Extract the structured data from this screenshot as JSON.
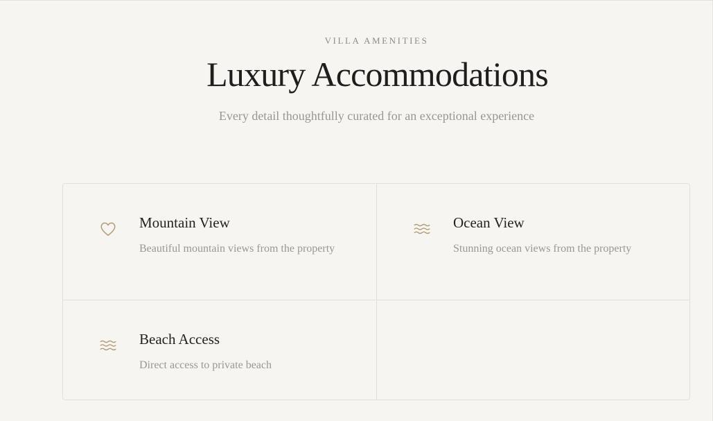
{
  "header": {
    "eyebrow": "VILLA AMENITIES",
    "title": "Luxury Accommodations",
    "subtitle": "Every detail thoughtfully curated for an exceptional experience"
  },
  "amenities": [
    {
      "icon": "heart-icon",
      "title": "Mountain View",
      "description": "Beautiful mountain views from the property"
    },
    {
      "icon": "waves-icon",
      "title": "Ocean View",
      "description": "Stunning ocean views from the property"
    },
    {
      "icon": "waves-icon",
      "title": "Beach Access",
      "description": "Direct access to private beach"
    }
  ],
  "colors": {
    "background": "#f6f5f2",
    "accent_icon": "#b59a72",
    "title_text": "#1f1e1c",
    "muted_text": "#9a968f",
    "border": "#e2e0db"
  }
}
